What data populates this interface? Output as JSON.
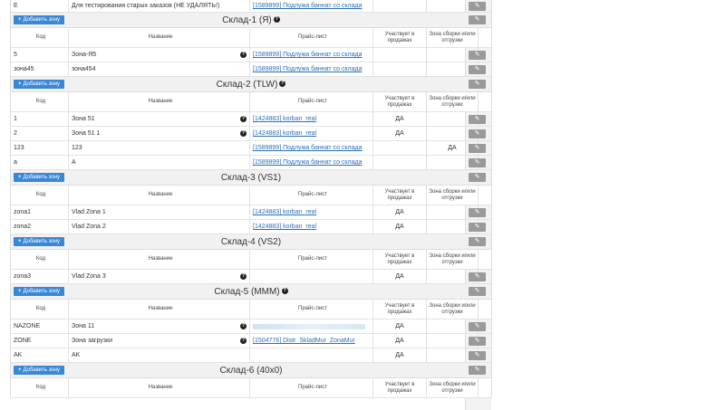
{
  "add_zone_label": "Добавить зону",
  "edit_icon": "pencil-icon",
  "columns": {
    "code": "Код",
    "name": "Название",
    "price": "Прайс-лист",
    "sales": "Участвует в продажах",
    "zone": "Зона сборки и/или отгрузки"
  },
  "top_row": {
    "code": "E",
    "name": "Для тестирования старых заказов (НЕ УДАЛЯТЬ!)",
    "price": "[1589899] Подлужа баннат со склада"
  },
  "sections": [
    {
      "title": "Склад-1 (Я)",
      "has_help": true,
      "rows": [
        {
          "code": "5",
          "name": "Зона-Я5",
          "help": true,
          "price": "[1589899] Подлужа баннат со склада",
          "sales": "",
          "zone": ""
        },
        {
          "code": "зона45",
          "name": "зона454",
          "help": false,
          "price": "[1589899] Подлужа баннат со склада",
          "sales": "",
          "zone": ""
        }
      ]
    },
    {
      "title": "Склад-2 (TLW)",
      "has_help": true,
      "rows": [
        {
          "code": "1",
          "name": "Зона 51",
          "help": true,
          "price": "[1424883] korban_real",
          "sales": "ДА",
          "zone": ""
        },
        {
          "code": "2",
          "name": "Зона 51 1",
          "help": true,
          "price": "[1424883] korban_real",
          "sales": "ДА",
          "zone": ""
        },
        {
          "code": "123",
          "name": "123",
          "help": false,
          "price": "[1589899] Подлужа баннат со склада",
          "sales": "",
          "zone": "ДА"
        },
        {
          "code": "a",
          "name": "A",
          "help": false,
          "price": "[1589899] Подлужа баннат со склада",
          "sales": "",
          "zone": ""
        }
      ]
    },
    {
      "title": "Склад-3 (VS1)",
      "has_help": false,
      "rows": [
        {
          "code": "zona1",
          "name": "Vlad Zona 1",
          "help": false,
          "price": "[1424883] korban_real",
          "sales": "ДА",
          "zone": ""
        },
        {
          "code": "zona2",
          "name": "Vlad Zona 2",
          "help": false,
          "price": "[1424883] korban_real",
          "sales": "ДА",
          "zone": ""
        }
      ]
    },
    {
      "title": "Склад-4 (VS2)",
      "has_help": false,
      "rows": [
        {
          "code": "zona3",
          "name": "Vlad Zona 3",
          "help": true,
          "price": "",
          "sales": "ДА",
          "zone": ""
        }
      ]
    },
    {
      "title": "Склад-5 (MMM)",
      "has_help": true,
      "rows": [
        {
          "code": "NAZONE",
          "name": "Зона 11",
          "help": true,
          "price": "",
          "blurred": true,
          "sales": "ДА",
          "zone": ""
        },
        {
          "code": "ZONE",
          "name": "Зона загрузки",
          "help": true,
          "price": "[1504776] Distr_SkladMur_ZonaMur",
          "sales": "ДА",
          "zone": ""
        },
        {
          "code": "AK",
          "name": "AK",
          "help": false,
          "price": "",
          "sales": "ДА",
          "zone": ""
        }
      ]
    },
    {
      "title": "Склад-6 (40x0)",
      "has_help": false,
      "rows": []
    }
  ]
}
